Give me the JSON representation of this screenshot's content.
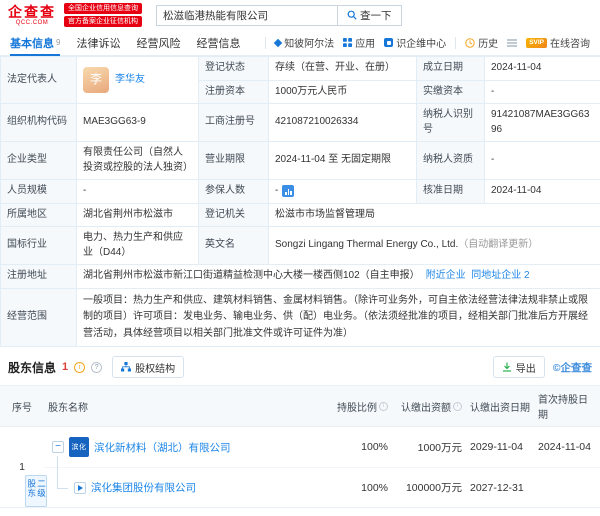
{
  "header": {
    "logo_text": "企查查",
    "logo_domain": "QCC.COM",
    "badge_top": "全国企业信用信息查询",
    "badge_bottom": "官方备案企业征信机构",
    "search_value": "松滋临港热能有限公司",
    "search_button": "查一下"
  },
  "tabs": {
    "basic": "基本信息",
    "basic_count": "9",
    "legal": "法律诉讼",
    "risk": "经营风险",
    "business": "经营信息",
    "zhibi": "知彼阿尔法",
    "apps": "应用",
    "shiqi": "识企维中心",
    "history": "历史",
    "svip": "SVIP",
    "consult": "在线咨询"
  },
  "icons": {
    "search": "magnifier",
    "zhibi": "diamond",
    "apps": "grid",
    "history": "clock",
    "menu": "hamburger-lines",
    "export": "download-arrow",
    "equity": "org-chart",
    "info": "i-circle",
    "help": "question-circle",
    "collapse": "minus-box",
    "expand": "triangle-right"
  },
  "info": {
    "legal_rep": {
      "label": "法定代表人",
      "avatar": "李",
      "name": "李华友"
    },
    "reg_status": {
      "label": "登记状态",
      "value": "存续（在营、开业、在册）"
    },
    "est_date": {
      "label": "成立日期",
      "value": "2024-11-04"
    },
    "reg_capital": {
      "label": "注册资本",
      "value": "1000万元人民币"
    },
    "paid_capital": {
      "label": "实缴资本",
      "value": "-"
    },
    "org_code": {
      "label": "组织机构代码",
      "value": "MAE3GG63-9"
    },
    "reg_no": {
      "label": "工商注册号",
      "value": "421087210026334"
    },
    "tax_no": {
      "label": "纳税人识别号",
      "value": "91421087MAE3GG6396"
    },
    "company_type": {
      "label": "企业类型",
      "value": "有限责任公司（自然人投资或控股的法人独资）"
    },
    "business_term": {
      "label": "营业期限",
      "value": "2024-11-04 至 无固定期限"
    },
    "tax_quality": {
      "label": "纳税人资质",
      "value": "-"
    },
    "staff_size": {
      "label": "人员规模",
      "value": "-"
    },
    "insured": {
      "label": "参保人数",
      "value": "-"
    },
    "approval_date": {
      "label": "核准日期",
      "value": "2024-11-04"
    },
    "region": {
      "label": "所属地区",
      "value": "湖北省荆州市松滋市"
    },
    "reg_authority": {
      "label": "登记机关",
      "value": "松滋市市场监督管理局"
    },
    "industry": {
      "label": "国标行业",
      "value": "电力、热力生产和供应业（D44）"
    },
    "en_name": {
      "label": "英文名",
      "value": "Songzi Lingang Thermal Energy Co., Ltd.",
      "note": "（自动翻译更新）"
    },
    "address": {
      "label": "注册地址",
      "value": "湖北省荆州市松滋市新江口街道精益检测中心大楼一楼西侧102（自主申报）",
      "link_nearby": "附近企业",
      "link_same": "同地址企业 2"
    },
    "scope": {
      "label": "经营范围",
      "value": "一般项目：热力生产和供应、建筑材料销售、金属材料销售。（除许可业务外，可自主依法经营法律法规非禁止或限制的项目）许可项目：发电业务、输电业务、供（配）电业务。（依法须经批准的项目，经相关部门批准后方开展经营活动，具体经营项目以相关部门批准文件或许可证件为准）"
    }
  },
  "shareholders": {
    "title": "股东信息",
    "count": "1",
    "equity_structure": "股权结构",
    "export": "导出",
    "watermark": "©企查查",
    "headers": {
      "no": "序号",
      "name": "股东名称",
      "ratio": "持股比例",
      "amount": "认缴出资额",
      "sub_date": "认缴出资日期",
      "first_date": "首次持股日期"
    },
    "row_no": "1",
    "level_tag": "二级股东",
    "main": {
      "logo": "滨化",
      "name": "滨化新材料（湖北）有限公司",
      "ratio": "100%",
      "amount": "1000万元",
      "sub_date": "2029-11-04",
      "first_date": "2024-11-04"
    },
    "child": {
      "name": "滨化集团股份有限公司",
      "ratio": "100%",
      "amount": "100000万元",
      "sub_date": "2027-12-31",
      "first_date": ""
    }
  }
}
